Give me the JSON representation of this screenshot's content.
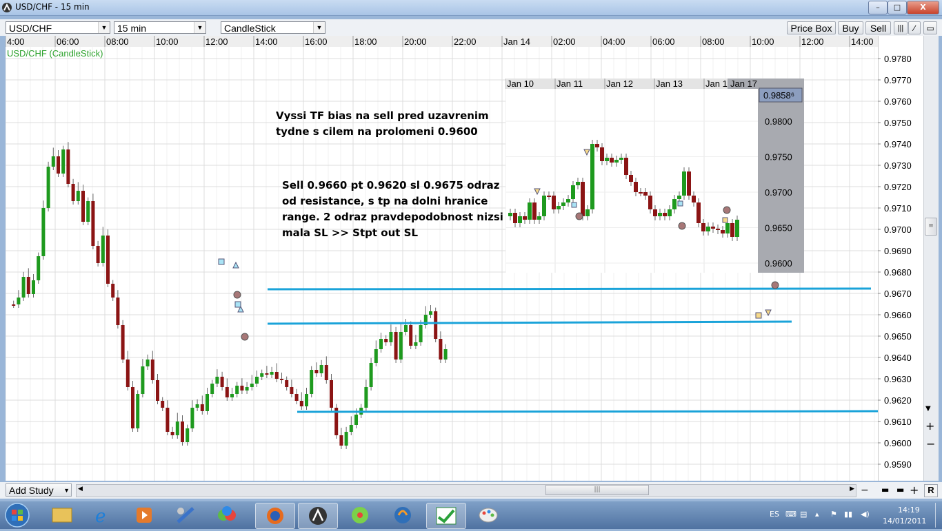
{
  "window": {
    "title": "USD/CHF - 15 min",
    "min_label": "–",
    "max_label": "□",
    "close_label": "X"
  },
  "toolbar": {
    "instrument": "USD/CHF",
    "timeframe": "15 min",
    "chart_type": "CandleStick",
    "price_box_label": "Price Box",
    "buy_label": "Buy",
    "sell_label": "Sell"
  },
  "chart": {
    "series_label": "USD/CHF (CandleStick)",
    "time_labels": [
      "4:00",
      "06:00",
      "08:00",
      "10:00",
      "12:00",
      "14:00",
      "16:00",
      "18:00",
      "20:00",
      "22:00",
      "Jan 14",
      "02:00",
      "04:00",
      "06:00",
      "08:00",
      "10:00",
      "12:00",
      "14:00"
    ],
    "price_labels": [
      "0.9780",
      "0.9770",
      "0.9760",
      "0.9750",
      "0.9740",
      "0.9730",
      "0.9720",
      "0.9710",
      "0.9700",
      "0.9690",
      "0.9680",
      "0.9670",
      "0.9660",
      "0.9650",
      "0.9640",
      "0.9630",
      "0.9620",
      "0.9610",
      "0.9600",
      "0.9590"
    ],
    "colors": {
      "up": "#1e9a1e",
      "down": "#8b1414",
      "line": "#1aa3d9",
      "grid": "#e3e3e3",
      "series_label": "#2aa12a"
    }
  },
  "annotations": {
    "note1": "Vyssi TF bias na sell pred uzavrenim\ntydne s cilem na prolomeni 0.9600",
    "note2": "Sell 0.9660 pt 0.9620 sl 0.9675 odraz\nod resistance, s tp na dolni hranice\nrange. 2 odraz pravdepodobnost nizsi\nmala SL  >> Stpt out SL"
  },
  "inset": {
    "date_labels": [
      "Jan 10",
      "Jan 11",
      "Jan 12",
      "Jan 13",
      "Jan 1"
    ],
    "current_label": "Jan 17",
    "price_box": "0.9858⁶",
    "price_labels": [
      "0.9800",
      "0.9750",
      "0.9700",
      "0.9650",
      "0.9600"
    ]
  },
  "bottom": {
    "add_study_label": "Add Study",
    "r_label": "R"
  },
  "taskbar": {
    "lang": "ES",
    "time": "14:19",
    "date": "14/01/2011"
  }
}
